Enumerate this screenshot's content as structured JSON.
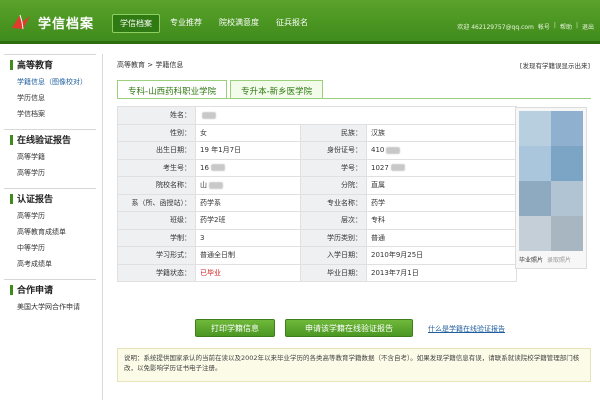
{
  "header": {
    "title": "学信档案",
    "nav": [
      "学信档案",
      "专业推荐",
      "院校满意度",
      "征兵报名"
    ],
    "welcome": "欢迎 462129757@qq.com",
    "account": "帐号",
    "help": "帮助",
    "logout": "退出",
    "colors": {
      "bar": "#4a9722",
      "accent": "#2f7a12"
    }
  },
  "sidebar": {
    "groups": [
      {
        "title": "高等教育",
        "items": [
          "学籍信息（图像校对）",
          "学历信息",
          "学信档案"
        ]
      },
      {
        "title": "在线验证报告",
        "items": [
          "高等学籍",
          "高等学历"
        ]
      },
      {
        "title": "认证报告",
        "items": [
          "高等学历",
          "高等教育成绩单",
          "中等学历",
          "高考成绩单"
        ]
      },
      {
        "title": "合作申请",
        "items": [
          "美国大学网合作申请"
        ]
      }
    ]
  },
  "main": {
    "breadcrumb": "高等教育 > 学籍信息",
    "report_link": "[发现有学籍误显示出来]",
    "tabs": [
      "专科-山西药科职业学院",
      "专升本-新乡医学院"
    ],
    "rows": [
      {
        "l1": "姓名：",
        "v1": "",
        "l2": "",
        "v2": ""
      },
      {
        "l1": "性别：",
        "v1": "女",
        "l2": "民族：",
        "v2": "汉族"
      },
      {
        "l1": "出生日期：",
        "v1": "19  年1月7日",
        "l2": "身份证号：",
        "v2": "410"
      },
      {
        "l1": "考生号：",
        "v1": "16",
        "l2": "学号：",
        "v2": "1027"
      },
      {
        "l1": "院校名称：",
        "v1": "山",
        "l2": "分院：",
        "v2": "直属"
      },
      {
        "l1": "系（所、函授站）：",
        "v1": "药学系",
        "l2": "专业名称：",
        "v2": "药学"
      },
      {
        "l1": "班级：",
        "v1": "药学2班",
        "l2": "层次：",
        "v2": "专科"
      },
      {
        "l1": "学制：",
        "v1": "3",
        "l2": "学历类别：",
        "v2": "普通"
      },
      {
        "l1": "学习形式：",
        "v1": "普通全日制",
        "l2": "入学日期：",
        "v2": "2010年9月25日"
      },
      {
        "l1": "学籍状态：",
        "v1": "已毕业",
        "l2": "毕业日期：",
        "v2": "2013年7月1日"
      }
    ],
    "photo_caption": "毕业照片",
    "photo_caption_2": "录取照片",
    "buttons": {
      "print": "打印学籍信息",
      "apply": "申请该学籍在线验证报告"
    },
    "how_link": "什么是学籍在线验证报告",
    "note": "说明：系统提供国家承认的当前在读以及2002年以来毕业学历的各类高等教育学籍数据（不含自考）。如果发现学籍信息有误，请联系就读院校学籍管理部门核改，以免影响学历证书电子注册。"
  }
}
